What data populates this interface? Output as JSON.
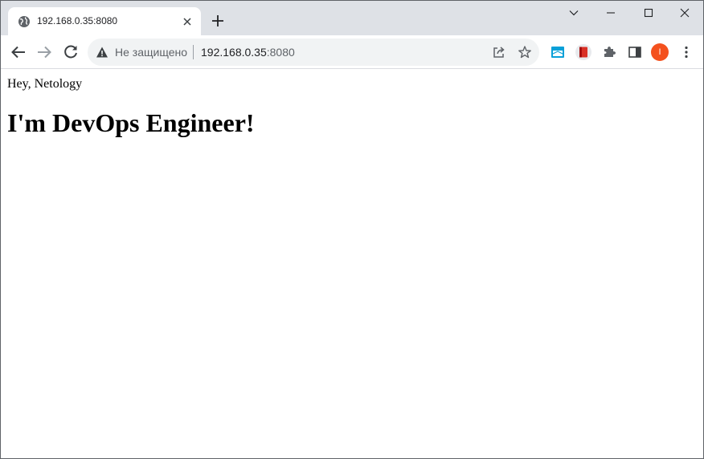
{
  "browser": {
    "tab": {
      "title": "192.168.0.35:8080",
      "favicon": "globe-icon"
    },
    "omnibox": {
      "security_label": "Не защищено",
      "url_host": "192.168.0.35",
      "url_port": ":8080"
    },
    "profile": {
      "initial": "I",
      "color": "#f4511e"
    },
    "colors": {
      "tabstrip": "#dee1e6",
      "omnibox": "#f1f3f4",
      "icon": "#5f6368"
    }
  },
  "page": {
    "greeting": "Hey, Netology",
    "heading": "I'm DevOps Engineer!"
  }
}
